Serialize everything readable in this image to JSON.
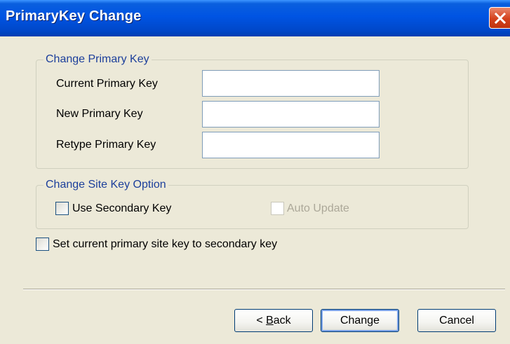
{
  "window": {
    "title": "PrimaryKey Change"
  },
  "change_primary_key": {
    "legend": "Change Primary Key",
    "current_label": "Current Primary Key",
    "current_value": "",
    "new_label": "New Primary Key",
    "new_value": "",
    "retype_label": "Retype Primary Key",
    "retype_value": ""
  },
  "site_key_option": {
    "legend": "Change Site Key Option",
    "use_secondary_label": "Use Secondary Key",
    "use_secondary_checked": false,
    "auto_update_label": "Auto Update",
    "auto_update_checked": false,
    "auto_update_enabled": false
  },
  "set_current_label": "Set current primary site key to secondary key",
  "set_current_checked": false,
  "buttons": {
    "back_prefix": "< ",
    "back_mnemonic": "B",
    "back_rest": "ack",
    "change": "Change",
    "cancel": "Cancel"
  },
  "colors": {
    "title_bar": "#0054e3",
    "dialog_background": "#ece9d8",
    "group_legend": "#1c3f9b",
    "close_button": "#d4411c"
  },
  "icons": {
    "close": "close-icon"
  }
}
